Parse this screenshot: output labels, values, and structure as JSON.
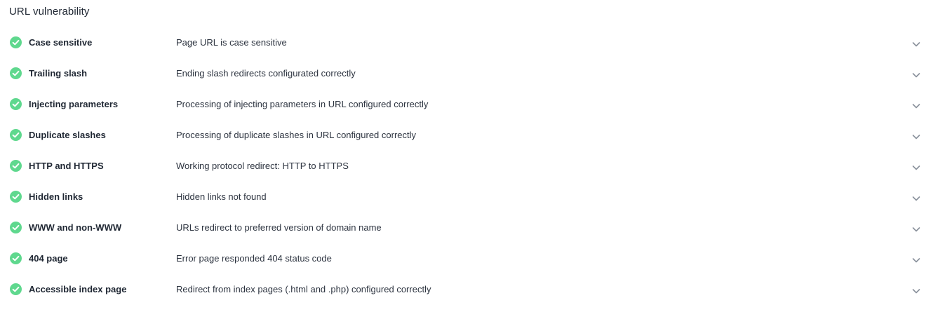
{
  "section": {
    "title": "URL vulnerability"
  },
  "colors": {
    "status_ok": "#5fd88e",
    "chevron": "#8a919c"
  },
  "checks": [
    {
      "name": "Case sensitive",
      "description": "Page URL is case sensitive",
      "status": "passed",
      "icon": "check-circle-icon"
    },
    {
      "name": "Trailing slash",
      "description": "Ending slash redirects configurated correctly",
      "status": "passed",
      "icon": "check-circle-icon"
    },
    {
      "name": "Injecting parameters",
      "description": "Processing of injecting parameters in URL configured correctly",
      "status": "passed",
      "icon": "check-circle-icon"
    },
    {
      "name": "Duplicate slashes",
      "description": "Processing of duplicate slashes in URL configured correctly",
      "status": "passed",
      "icon": "check-circle-icon"
    },
    {
      "name": "HTTP and HTTPS",
      "description": "Working protocol redirect: HTTP to HTTPS",
      "status": "passed",
      "icon": "check-circle-icon"
    },
    {
      "name": "Hidden links",
      "description": "Hidden links not found",
      "status": "passed",
      "icon": "check-circle-icon"
    },
    {
      "name": "WWW and non-WWW",
      "description": "URLs redirect to preferred version of domain name",
      "status": "passed",
      "icon": "check-circle-icon"
    },
    {
      "name": "404 page",
      "description": "Error page responded 404 status code",
      "status": "passed",
      "icon": "check-circle-icon"
    },
    {
      "name": "Accessible index page",
      "description": "Redirect from index pages (.html and .php) configured correctly",
      "status": "passed",
      "icon": "check-circle-icon"
    }
  ]
}
